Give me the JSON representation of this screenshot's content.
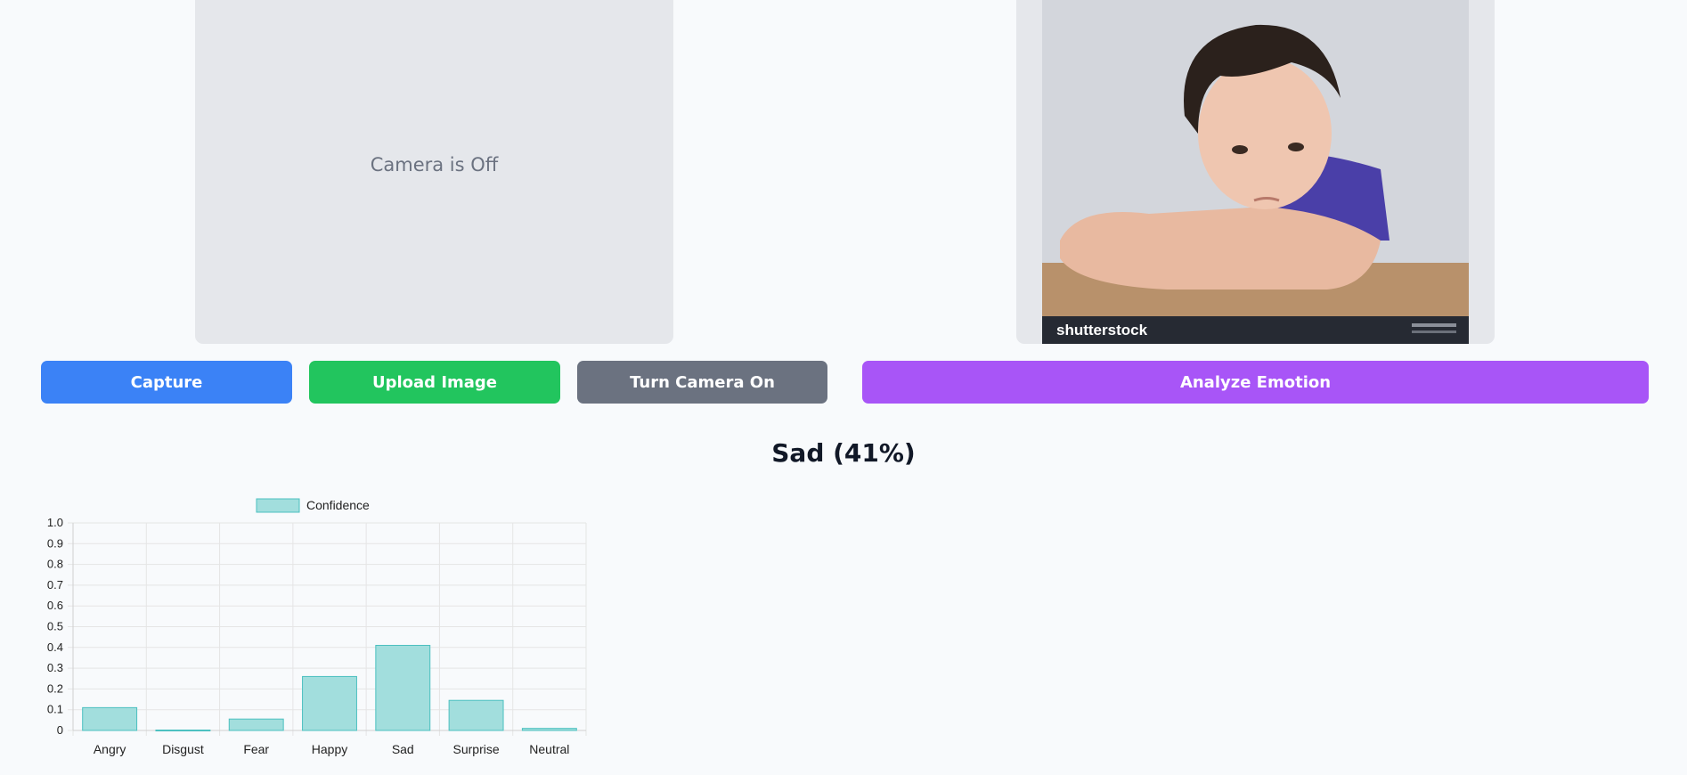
{
  "camera": {
    "status_text": "Camera is Off"
  },
  "photo": {
    "description_icon": "child-photo",
    "watermark": "shutterstock"
  },
  "buttons": {
    "capture": "Capture",
    "upload": "Upload Image",
    "camera_toggle": "Turn Camera On",
    "analyze": "Analyze Emotion"
  },
  "result": {
    "label": "Sad (41%)"
  },
  "colors": {
    "capture": "#3b82f6",
    "upload": "#22c55e",
    "camera_toggle": "#6b7280",
    "analyze": "#a855f7",
    "bar_fill": "#a2dedd",
    "bar_border": "#4bc0c0"
  },
  "chart_data": {
    "type": "bar",
    "categories": [
      "Angry",
      "Disgust",
      "Fear",
      "Happy",
      "Sad",
      "Surprise",
      "Neutral"
    ],
    "series": [
      {
        "name": "Confidence",
        "values": [
          0.11,
          0.002,
          0.055,
          0.26,
          0.41,
          0.145,
          0.01
        ]
      }
    ],
    "title": "",
    "xlabel": "",
    "ylabel": "",
    "ylim": [
      0,
      1.0
    ],
    "yticks": [
      "0",
      "0.1",
      "0.2",
      "0.3",
      "0.4",
      "0.5",
      "0.6",
      "0.7",
      "0.8",
      "0.9",
      "1.0"
    ],
    "legend": "top-center",
    "grid": true
  }
}
